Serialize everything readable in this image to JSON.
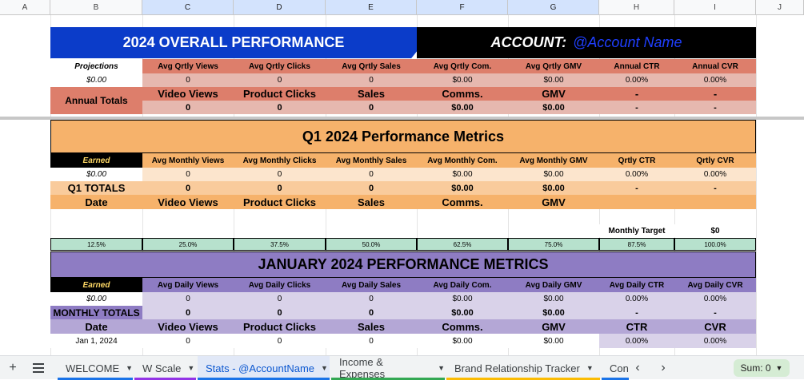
{
  "columns": [
    "A",
    "B",
    "C",
    "D",
    "E",
    "F",
    "G",
    "H",
    "I",
    "J"
  ],
  "overall": {
    "title": "2024 OVERALL PERFORMANCE",
    "account_label": "ACCOUNT:",
    "account_name": "@Account Name",
    "headers": [
      "Projections",
      "Avg Qrtly Views",
      "Avg Qrtly Clicks",
      "Avg Qrtly Sales",
      "Avg Qrtly Com.",
      "Avg Qrtly GMV",
      "Annual CTR",
      "Annual CVR"
    ],
    "values": [
      "$0.00",
      "0",
      "0",
      "0",
      "$0.00",
      "$0.00",
      "0.00%",
      "0.00%"
    ],
    "totals_label": "Annual Totals",
    "total_headers": [
      "Video Views",
      "Product Clicks",
      "Sales",
      "Comms.",
      "GMV",
      "-",
      "-"
    ],
    "totals": [
      "0",
      "0",
      "0",
      "$0.00",
      "$0.00",
      "-",
      "-"
    ]
  },
  "q1": {
    "title": "Q1 2024 Performance Metrics",
    "headers": [
      "Earned",
      "Avg Monthly Views",
      "Avg Monthly Clicks",
      "Avg Monthly Sales",
      "Avg Monthly Com.",
      "Avg Monthly GMV",
      "Qrtly CTR",
      "Qrtly CVR"
    ],
    "values": [
      "$0.00",
      "0",
      "0",
      "0",
      "$0.00",
      "$0.00",
      "0.00%",
      "0.00%"
    ],
    "totals": [
      "Q1 TOTALS",
      "0",
      "0",
      "0",
      "$0.00",
      "$0.00",
      "-",
      "-"
    ],
    "date_row": [
      "Date",
      "Video Views",
      "Product Clicks",
      "Sales",
      "Comms.",
      "GMV",
      "",
      ""
    ]
  },
  "target": {
    "label": "Monthly Target",
    "value": "$0"
  },
  "percent_row": [
    "12.5%",
    "25.0%",
    "37.5%",
    "50.0%",
    "62.5%",
    "75.0%",
    "87.5%",
    "100.0%"
  ],
  "january": {
    "title": "JANUARY 2024 PERFORMANCE METRICS",
    "headers": [
      "Earned",
      "Avg Daily Views",
      "Avg Daily Clicks",
      "Avg Daily Sales",
      "Avg Daily Com.",
      "Avg Daily GMV",
      "Avg Daily CTR",
      "Avg Daily CVR"
    ],
    "values": [
      "$0.00",
      "0",
      "0",
      "0",
      "$0.00",
      "$0.00",
      "0.00%",
      "0.00%"
    ],
    "totals": [
      "MONTHLY TOTALS",
      "0",
      "0",
      "0",
      "$0.00",
      "$0.00",
      "-",
      "-"
    ],
    "date_row": [
      "Date",
      "Video Views",
      "Product Clicks",
      "Sales",
      "Comms.",
      "GMV",
      "CTR",
      "CVR"
    ],
    "first_day": [
      "Jan 1, 2024",
      "0",
      "0",
      "0",
      "$0.00",
      "$0.00",
      "0.00%",
      "0.00%"
    ]
  },
  "tabs": [
    {
      "label": "WELCOME",
      "color": "#1a73e8"
    },
    {
      "label": "W Scale",
      "color": "#9334e6"
    },
    {
      "label": "Stats - @AccountName",
      "color": "#1a73e8"
    },
    {
      "label": "Income & Expenses",
      "color": "#34a853"
    },
    {
      "label": "Brand Relationship Tracker",
      "color": "#fbbc04"
    },
    {
      "label": "Con",
      "color": "#1a73e8"
    }
  ],
  "sum": "Sum: 0",
  "colors": {
    "overall_header": "#dd7e6b",
    "overall_value": "#e6b8af",
    "overall_banner": "#0b3cc9",
    "q1_main": "#f6b26b",
    "q1_light": "#fce5cd",
    "q1_mid": "#f9cb9c",
    "target_green": "#b7e1cd",
    "jan_main": "#8e7cc3",
    "jan_light": "#d9d2e9",
    "jan_mid": "#b4a7d6"
  }
}
